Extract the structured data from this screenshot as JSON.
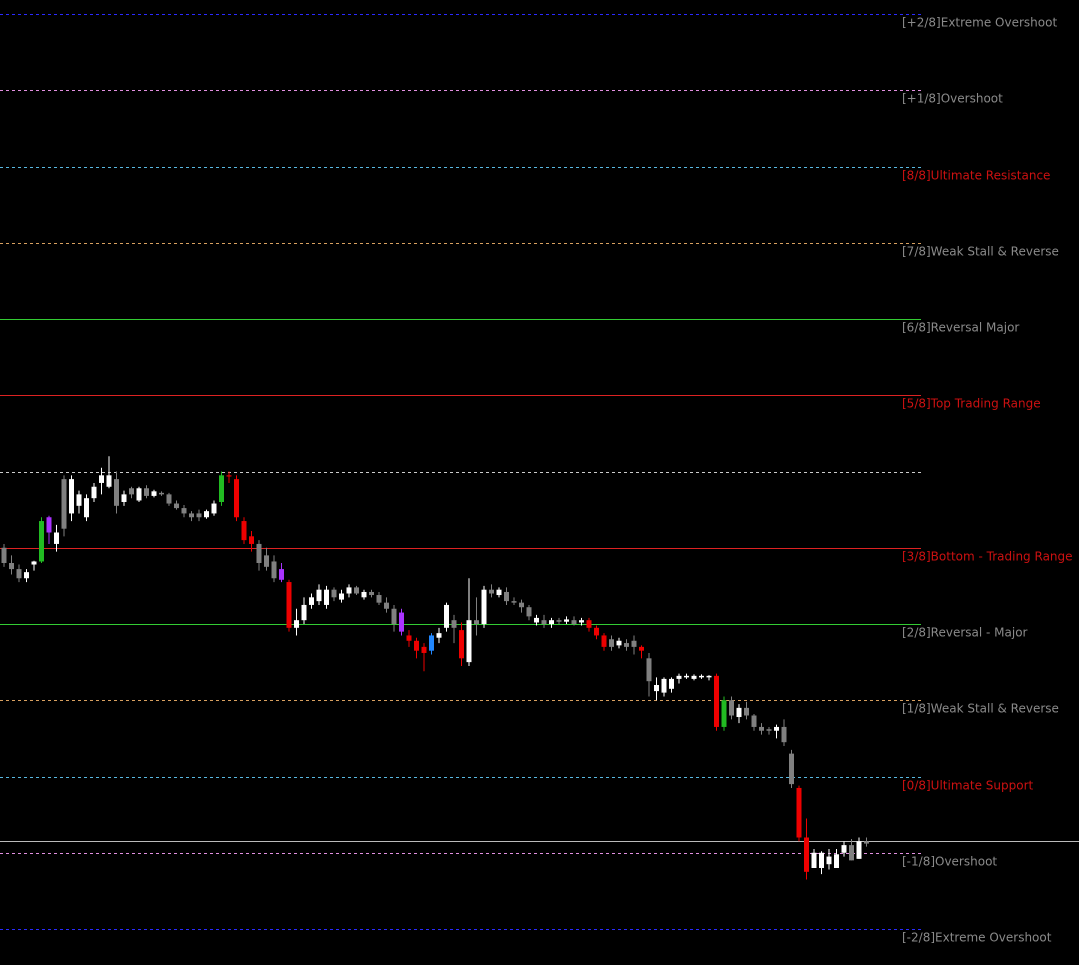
{
  "chart_data": {
    "type": "candlestick",
    "title": "",
    "background": "#000000",
    "levels": [
      {
        "label": "[+2/8]Extreme Overshoot",
        "value": 10,
        "line_color": "#2a2aff",
        "label_color": "#8a8a8a",
        "style": "dashed"
      },
      {
        "label": "[+1/8]Overshoot",
        "value": 9,
        "line_color": "#e28fe0",
        "label_color": "#8a8a8a",
        "style": "dashed"
      },
      {
        "label": "[8/8]Ultimate Resistance",
        "value": 8,
        "line_color": "#58b8e0",
        "label_color": "#cc1111",
        "style": "dashed"
      },
      {
        "label": "[7/8]Weak Stall & Reverse",
        "value": 7,
        "line_color": "#d8a060",
        "label_color": "#8a8a8a",
        "style": "dashed"
      },
      {
        "label": "[6/8]Reversal Major",
        "value": 6,
        "line_color": "#33cc33",
        "label_color": "#8a8a8a",
        "style": "solid"
      },
      {
        "label": "[5/8]Top Trading Range",
        "value": 5,
        "line_color": "#dd2222",
        "label_color": "#cc1111",
        "style": "solid"
      },
      {
        "label": "",
        "value": 4,
        "line_color": "#cccccc",
        "label_color": "#8a8a8a",
        "style": "dashed"
      },
      {
        "label": "[3/8]Bottom - Trading Range",
        "value": 3,
        "line_color": "#dd2222",
        "label_color": "#cc1111",
        "style": "solid"
      },
      {
        "label": "[2/8]Reversal - Major",
        "value": 2,
        "line_color": "#33cc33",
        "label_color": "#8a8a8a",
        "style": "solid"
      },
      {
        "label": "[1/8]Weak Stall & Reverse",
        "value": 1,
        "line_color": "#d8a060",
        "label_color": "#8a8a8a",
        "style": "dashed"
      },
      {
        "label": "[0/8]Ultimate Support",
        "value": 0,
        "line_color": "#58b8e0",
        "label_color": "#cc1111",
        "style": "dashed"
      },
      {
        "label": "[-1/8]Overshoot",
        "value": -1,
        "line_color": "#e28fe0",
        "label_color": "#8a8a8a",
        "style": "dashed"
      },
      {
        "label": "[-2/8]Extreme Overshoot",
        "value": -2,
        "line_color": "#2a2aff",
        "label_color": "#8a8a8a",
        "style": "dashed"
      }
    ],
    "current_price": -0.85,
    "current_price_color": "#bbbbbb",
    "colors": {
      "up": "#ffffff",
      "down": "#808080",
      "strong_up": "#22bb22",
      "strong_down": "#ee0000",
      "purple": "#aa33ff",
      "blue": "#2288ff"
    },
    "candles": [
      {
        "o": 3.0,
        "h": 3.05,
        "l": 2.75,
        "c": 2.8,
        "k": "down"
      },
      {
        "o": 2.8,
        "h": 2.9,
        "l": 2.65,
        "c": 2.72,
        "k": "down"
      },
      {
        "o": 2.72,
        "h": 2.78,
        "l": 2.55,
        "c": 2.6,
        "k": "down"
      },
      {
        "o": 2.6,
        "h": 2.72,
        "l": 2.55,
        "c": 2.68,
        "k": "up"
      },
      {
        "o": 2.78,
        "h": 2.83,
        "l": 2.7,
        "c": 2.82,
        "k": "up"
      },
      {
        "o": 2.82,
        "h": 3.4,
        "l": 2.8,
        "c": 3.35,
        "k": "strong_up"
      },
      {
        "o": 3.2,
        "h": 3.42,
        "l": 3.05,
        "c": 3.4,
        "k": "purple"
      },
      {
        "o": 3.05,
        "h": 3.3,
        "l": 2.95,
        "c": 3.2,
        "k": "up"
      },
      {
        "o": 3.25,
        "h": 3.95,
        "l": 3.15,
        "c": 3.9,
        "k": "down"
      },
      {
        "o": 3.45,
        "h": 3.95,
        "l": 3.35,
        "c": 3.9,
        "k": "up"
      },
      {
        "o": 3.55,
        "h": 3.75,
        "l": 3.45,
        "c": 3.7,
        "k": "up"
      },
      {
        "o": 3.4,
        "h": 3.7,
        "l": 3.35,
        "c": 3.65,
        "k": "up"
      },
      {
        "o": 3.65,
        "h": 3.85,
        "l": 3.6,
        "c": 3.8,
        "k": "up"
      },
      {
        "o": 3.85,
        "h": 4.05,
        "l": 3.7,
        "c": 3.95,
        "k": "up"
      },
      {
        "o": 3.8,
        "h": 4.2,
        "l": 3.78,
        "c": 3.95,
        "k": "up"
      },
      {
        "o": 3.9,
        "h": 4.0,
        "l": 3.45,
        "c": 3.55,
        "k": "down"
      },
      {
        "o": 3.6,
        "h": 3.75,
        "l": 3.55,
        "c": 3.7,
        "k": "up"
      },
      {
        "o": 3.7,
        "h": 3.8,
        "l": 3.65,
        "c": 3.78,
        "k": "down"
      },
      {
        "o": 3.62,
        "h": 3.8,
        "l": 3.6,
        "c": 3.78,
        "k": "up"
      },
      {
        "o": 3.78,
        "h": 3.82,
        "l": 3.65,
        "c": 3.68,
        "k": "down"
      },
      {
        "o": 3.68,
        "h": 3.76,
        "l": 3.66,
        "c": 3.74,
        "k": "up"
      },
      {
        "o": 3.72,
        "h": 3.74,
        "l": 3.68,
        "c": 3.7,
        "k": "down"
      },
      {
        "o": 3.7,
        "h": 3.72,
        "l": 3.55,
        "c": 3.58,
        "k": "down"
      },
      {
        "o": 3.58,
        "h": 3.62,
        "l": 3.5,
        "c": 3.52,
        "k": "down"
      },
      {
        "o": 3.52,
        "h": 3.56,
        "l": 3.4,
        "c": 3.45,
        "k": "down"
      },
      {
        "o": 3.45,
        "h": 3.48,
        "l": 3.35,
        "c": 3.4,
        "k": "down"
      },
      {
        "o": 3.4,
        "h": 3.5,
        "l": 3.35,
        "c": 3.45,
        "k": "down"
      },
      {
        "o": 3.4,
        "h": 3.5,
        "l": 3.38,
        "c": 3.48,
        "k": "up"
      },
      {
        "o": 3.45,
        "h": 3.62,
        "l": 3.42,
        "c": 3.58,
        "k": "up"
      },
      {
        "o": 3.6,
        "h": 4.0,
        "l": 3.55,
        "c": 3.95,
        "k": "strong_up"
      },
      {
        "o": 3.95,
        "h": 4.0,
        "l": 3.85,
        "c": 3.95,
        "k": "strong_down"
      },
      {
        "o": 3.9,
        "h": 3.95,
        "l": 3.35,
        "c": 3.4,
        "k": "strong_down"
      },
      {
        "o": 3.35,
        "h": 3.4,
        "l": 3.05,
        "c": 3.1,
        "k": "strong_down"
      },
      {
        "o": 3.15,
        "h": 3.22,
        "l": 2.95,
        "c": 3.05,
        "k": "strong_down"
      },
      {
        "o": 3.05,
        "h": 3.1,
        "l": 2.7,
        "c": 2.8,
        "k": "down"
      },
      {
        "o": 2.9,
        "h": 3.0,
        "l": 2.7,
        "c": 2.75,
        "k": "down"
      },
      {
        "o": 2.82,
        "h": 2.9,
        "l": 2.55,
        "c": 2.6,
        "k": "down"
      },
      {
        "o": 2.72,
        "h": 2.8,
        "l": 2.55,
        "c": 2.58,
        "k": "purple"
      },
      {
        "o": 2.55,
        "h": 2.58,
        "l": 1.9,
        "c": 1.95,
        "k": "strong_down"
      },
      {
        "o": 1.95,
        "h": 2.2,
        "l": 1.85,
        "c": 2.05,
        "k": "up"
      },
      {
        "o": 2.05,
        "h": 2.35,
        "l": 2.0,
        "c": 2.25,
        "k": "up"
      },
      {
        "o": 2.25,
        "h": 2.4,
        "l": 2.2,
        "c": 2.35,
        "k": "up"
      },
      {
        "o": 2.3,
        "h": 2.52,
        "l": 2.25,
        "c": 2.45,
        "k": "up"
      },
      {
        "o": 2.25,
        "h": 2.5,
        "l": 2.2,
        "c": 2.45,
        "k": "up"
      },
      {
        "o": 2.45,
        "h": 2.48,
        "l": 2.3,
        "c": 2.35,
        "k": "down"
      },
      {
        "o": 2.32,
        "h": 2.45,
        "l": 2.28,
        "c": 2.4,
        "k": "up"
      },
      {
        "o": 2.4,
        "h": 2.52,
        "l": 2.35,
        "c": 2.48,
        "k": "up"
      },
      {
        "o": 2.48,
        "h": 2.5,
        "l": 2.38,
        "c": 2.4,
        "k": "down"
      },
      {
        "o": 2.35,
        "h": 2.45,
        "l": 2.32,
        "c": 2.42,
        "k": "up"
      },
      {
        "o": 2.42,
        "h": 2.45,
        "l": 2.35,
        "c": 2.38,
        "k": "down"
      },
      {
        "o": 2.38,
        "h": 2.42,
        "l": 2.25,
        "c": 2.28,
        "k": "down"
      },
      {
        "o": 2.28,
        "h": 2.35,
        "l": 2.15,
        "c": 2.2,
        "k": "down"
      },
      {
        "o": 2.2,
        "h": 2.25,
        "l": 1.9,
        "c": 2.0,
        "k": "down"
      },
      {
        "o": 2.15,
        "h": 2.2,
        "l": 1.85,
        "c": 1.9,
        "k": "purple"
      },
      {
        "o": 1.85,
        "h": 1.92,
        "l": 1.7,
        "c": 1.78,
        "k": "strong_down"
      },
      {
        "o": 1.78,
        "h": 1.82,
        "l": 1.55,
        "c": 1.65,
        "k": "strong_down"
      },
      {
        "o": 1.7,
        "h": 1.75,
        "l": 1.38,
        "c": 1.62,
        "k": "strong_down"
      },
      {
        "o": 1.65,
        "h": 1.88,
        "l": 1.6,
        "c": 1.85,
        "k": "blue"
      },
      {
        "o": 1.82,
        "h": 1.95,
        "l": 1.75,
        "c": 1.88,
        "k": "up"
      },
      {
        "o": 1.95,
        "h": 2.28,
        "l": 1.9,
        "c": 2.25,
        "k": "up"
      },
      {
        "o": 1.95,
        "h": 2.12,
        "l": 1.75,
        "c": 2.05,
        "k": "down"
      },
      {
        "o": 1.92,
        "h": 2.02,
        "l": 1.45,
        "c": 1.55,
        "k": "strong_down"
      },
      {
        "o": 1.5,
        "h": 2.6,
        "l": 1.45,
        "c": 2.05,
        "k": "up"
      },
      {
        "o": 2.05,
        "h": 2.35,
        "l": 1.85,
        "c": 2.0,
        "k": "down"
      },
      {
        "o": 2.0,
        "h": 2.5,
        "l": 1.95,
        "c": 2.45,
        "k": "up"
      },
      {
        "o": 2.45,
        "h": 2.52,
        "l": 2.35,
        "c": 2.4,
        "k": "down"
      },
      {
        "o": 2.38,
        "h": 2.48,
        "l": 2.35,
        "c": 2.45,
        "k": "up"
      },
      {
        "o": 2.42,
        "h": 2.48,
        "l": 2.25,
        "c": 2.3,
        "k": "down"
      },
      {
        "o": 2.3,
        "h": 2.35,
        "l": 2.25,
        "c": 2.28,
        "k": "down"
      },
      {
        "o": 2.28,
        "h": 2.32,
        "l": 2.15,
        "c": 2.22,
        "k": "down"
      },
      {
        "o": 2.22,
        "h": 2.25,
        "l": 2.05,
        "c": 2.1,
        "k": "down"
      },
      {
        "o": 2.02,
        "h": 2.12,
        "l": 1.98,
        "c": 2.08,
        "k": "up"
      },
      {
        "o": 2.05,
        "h": 2.12,
        "l": 1.95,
        "c": 2.0,
        "k": "down"
      },
      {
        "o": 2.0,
        "h": 2.08,
        "l": 1.95,
        "c": 2.05,
        "k": "up"
      },
      {
        "o": 2.05,
        "h": 2.08,
        "l": 2.0,
        "c": 2.03,
        "k": "down"
      },
      {
        "o": 2.03,
        "h": 2.1,
        "l": 2.0,
        "c": 2.06,
        "k": "up"
      },
      {
        "o": 2.05,
        "h": 2.1,
        "l": 1.98,
        "c": 2.0,
        "k": "down"
      },
      {
        "o": 2.02,
        "h": 2.08,
        "l": 1.98,
        "c": 2.05,
        "k": "up"
      },
      {
        "o": 2.05,
        "h": 2.08,
        "l": 1.9,
        "c": 1.95,
        "k": "strong_down"
      },
      {
        "o": 1.95,
        "h": 1.98,
        "l": 1.8,
        "c": 1.85,
        "k": "strong_down"
      },
      {
        "o": 1.85,
        "h": 1.88,
        "l": 1.65,
        "c": 1.7,
        "k": "strong_down"
      },
      {
        "o": 1.7,
        "h": 1.85,
        "l": 1.65,
        "c": 1.8,
        "k": "down"
      },
      {
        "o": 1.72,
        "h": 1.82,
        "l": 1.68,
        "c": 1.78,
        "k": "up"
      },
      {
        "o": 1.75,
        "h": 1.8,
        "l": 1.65,
        "c": 1.7,
        "k": "down"
      },
      {
        "o": 1.7,
        "h": 1.85,
        "l": 1.6,
        "c": 1.78,
        "k": "down"
      },
      {
        "o": 1.65,
        "h": 1.72,
        "l": 1.55,
        "c": 1.7,
        "k": "strong_down"
      },
      {
        "o": 1.55,
        "h": 1.62,
        "l": 1.05,
        "c": 1.25,
        "k": "down"
      },
      {
        "o": 1.12,
        "h": 1.3,
        "l": 1.0,
        "c": 1.2,
        "k": "up"
      },
      {
        "o": 1.1,
        "h": 1.3,
        "l": 1.05,
        "c": 1.28,
        "k": "up"
      },
      {
        "o": 1.15,
        "h": 1.3,
        "l": 1.1,
        "c": 1.28,
        "k": "up"
      },
      {
        "o": 1.28,
        "h": 1.35,
        "l": 1.22,
        "c": 1.32,
        "k": "up"
      },
      {
        "o": 1.32,
        "h": 1.35,
        "l": 1.28,
        "c": 1.3,
        "k": "up"
      },
      {
        "o": 1.28,
        "h": 1.34,
        "l": 1.26,
        "c": 1.32,
        "k": "up"
      },
      {
        "o": 1.32,
        "h": 1.34,
        "l": 1.28,
        "c": 1.3,
        "k": "up"
      },
      {
        "o": 1.3,
        "h": 1.33,
        "l": 1.26,
        "c": 1.32,
        "k": "up"
      },
      {
        "o": 1.32,
        "h": 1.35,
        "l": 0.6,
        "c": 0.65,
        "k": "strong_down"
      },
      {
        "o": 0.65,
        "h": 1.05,
        "l": 0.6,
        "c": 1.0,
        "k": "strong_up"
      },
      {
        "o": 1.0,
        "h": 1.05,
        "l": 0.75,
        "c": 0.8,
        "k": "down"
      },
      {
        "o": 0.78,
        "h": 0.95,
        "l": 0.7,
        "c": 0.9,
        "k": "up"
      },
      {
        "o": 0.9,
        "h": 0.98,
        "l": 0.75,
        "c": 0.8,
        "k": "down"
      },
      {
        "o": 0.8,
        "h": 0.82,
        "l": 0.6,
        "c": 0.65,
        "k": "down"
      },
      {
        "o": 0.65,
        "h": 0.7,
        "l": 0.55,
        "c": 0.6,
        "k": "down"
      },
      {
        "o": 0.6,
        "h": 0.65,
        "l": 0.55,
        "c": 0.62,
        "k": "down"
      },
      {
        "o": 0.6,
        "h": 0.68,
        "l": 0.5,
        "c": 0.65,
        "k": "up"
      },
      {
        "o": 0.65,
        "h": 0.75,
        "l": 0.4,
        "c": 0.45,
        "k": "down"
      },
      {
        "o": 0.3,
        "h": 0.35,
        "l": -0.15,
        "c": -0.1,
        "k": "down"
      },
      {
        "o": -0.15,
        "h": -0.12,
        "l": -0.85,
        "c": -0.8,
        "k": "strong_down"
      },
      {
        "o": -0.8,
        "h": -0.55,
        "l": -1.35,
        "c": -1.25,
        "k": "strong_down"
      },
      {
        "o": -1.2,
        "h": -0.95,
        "l": -1.2,
        "c": -1.0,
        "k": "up"
      },
      {
        "o": -1.0,
        "h": -0.98,
        "l": -1.28,
        "c": -1.2,
        "k": "up"
      },
      {
        "o": -1.15,
        "h": -0.95,
        "l": -1.22,
        "c": -1.05,
        "k": "up"
      },
      {
        "o": -1.2,
        "h": -0.95,
        "l": -1.2,
        "c": -1.02,
        "k": "up"
      },
      {
        "o": -1.0,
        "h": -0.85,
        "l": -1.05,
        "c": -0.9,
        "k": "up"
      },
      {
        "o": -1.1,
        "h": -0.82,
        "l": -1.1,
        "c": -0.9,
        "k": "down"
      },
      {
        "o": -1.08,
        "h": -0.8,
        "l": -1.08,
        "c": -0.85,
        "k": "up"
      },
      {
        "o": -0.88,
        "h": -0.8,
        "l": -0.92,
        "c": -0.85,
        "k": "down"
      }
    ]
  }
}
